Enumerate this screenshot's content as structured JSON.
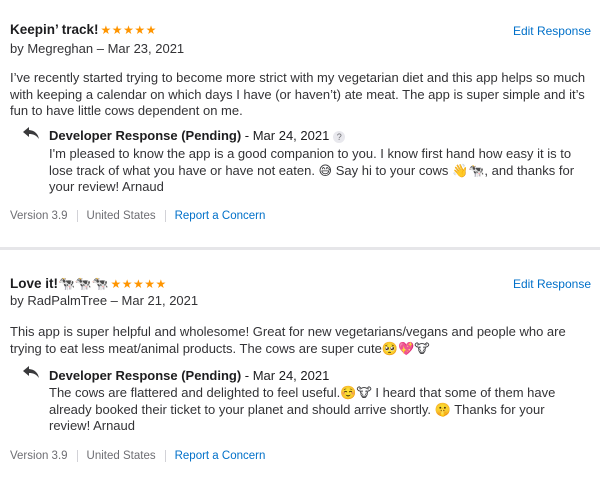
{
  "reviews": [
    {
      "title": "Keepin’ track!",
      "stars": "★★★★★",
      "edit_label": "Edit Response",
      "byline": "by Megreghan – Mar 23, 2021",
      "body": "I’ve recently started trying to become more strict with my vegetarian diet and this app helps so much with keeping a calendar on which days I have (or haven’t) ate meat. The app is super simple and it’s fun to have little cows dependent on me.",
      "developer_response": {
        "label": "Developer Response (Pending)",
        "date": " - Mar 24, 2021",
        "body": "I'm pleased to know the app is a good companion to you. I know first hand how easy it is to lose track of what you have or have not eaten. 😅 Say hi to your cows 👋🐄, and thanks for your review! Arnaud"
      },
      "version": "Version 3.9",
      "country": "United States",
      "report_label": "Report a Concern"
    },
    {
      "title": "Love it!🐄🐄🐄",
      "stars": "★★★★★",
      "edit_label": "Edit Response",
      "byline": "by RadPalmTree – Mar 21, 2021",
      "body": "This app is super helpful and wholesome! Great for new vegetarians/vegans and people who are trying to eat less meat/animal products. The cows are super cute🥺💖🐮",
      "developer_response": {
        "label": "Developer Response (Pending)",
        "date": " - Mar 24, 2021",
        "body": "The cows are flattered and delighted to feel useful.☺️🐮 I heard that some of them have already booked their ticket to your planet and should arrive shortly. 🤫 Thanks for your review! Arnaud"
      },
      "version": "Version 3.9",
      "country": "United States",
      "report_label": "Report a Concern"
    }
  ],
  "colors": {
    "accent": "#0070c9",
    "stars": "#ff9500",
    "muted": "#6e6e73"
  },
  "icons": {
    "reply": "reply-arrow-icon",
    "help": "question-mark-icon"
  },
  "help_glyph": "?"
}
